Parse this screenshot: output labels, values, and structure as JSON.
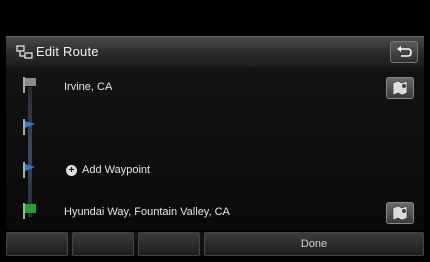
{
  "header": {
    "title": "Edit Route"
  },
  "route": {
    "origin": "Irvine, CA",
    "add_waypoint_label": "Add Waypoint",
    "destination": "Hyundai Way, Fountain Valley, CA"
  },
  "toolbar": {
    "btn1_label": "",
    "btn2_label": "",
    "btn3_label": "",
    "done_label": "Done"
  },
  "colors": {
    "accent_blue": "#2f7ad8",
    "dest_green": "#23a03a"
  }
}
